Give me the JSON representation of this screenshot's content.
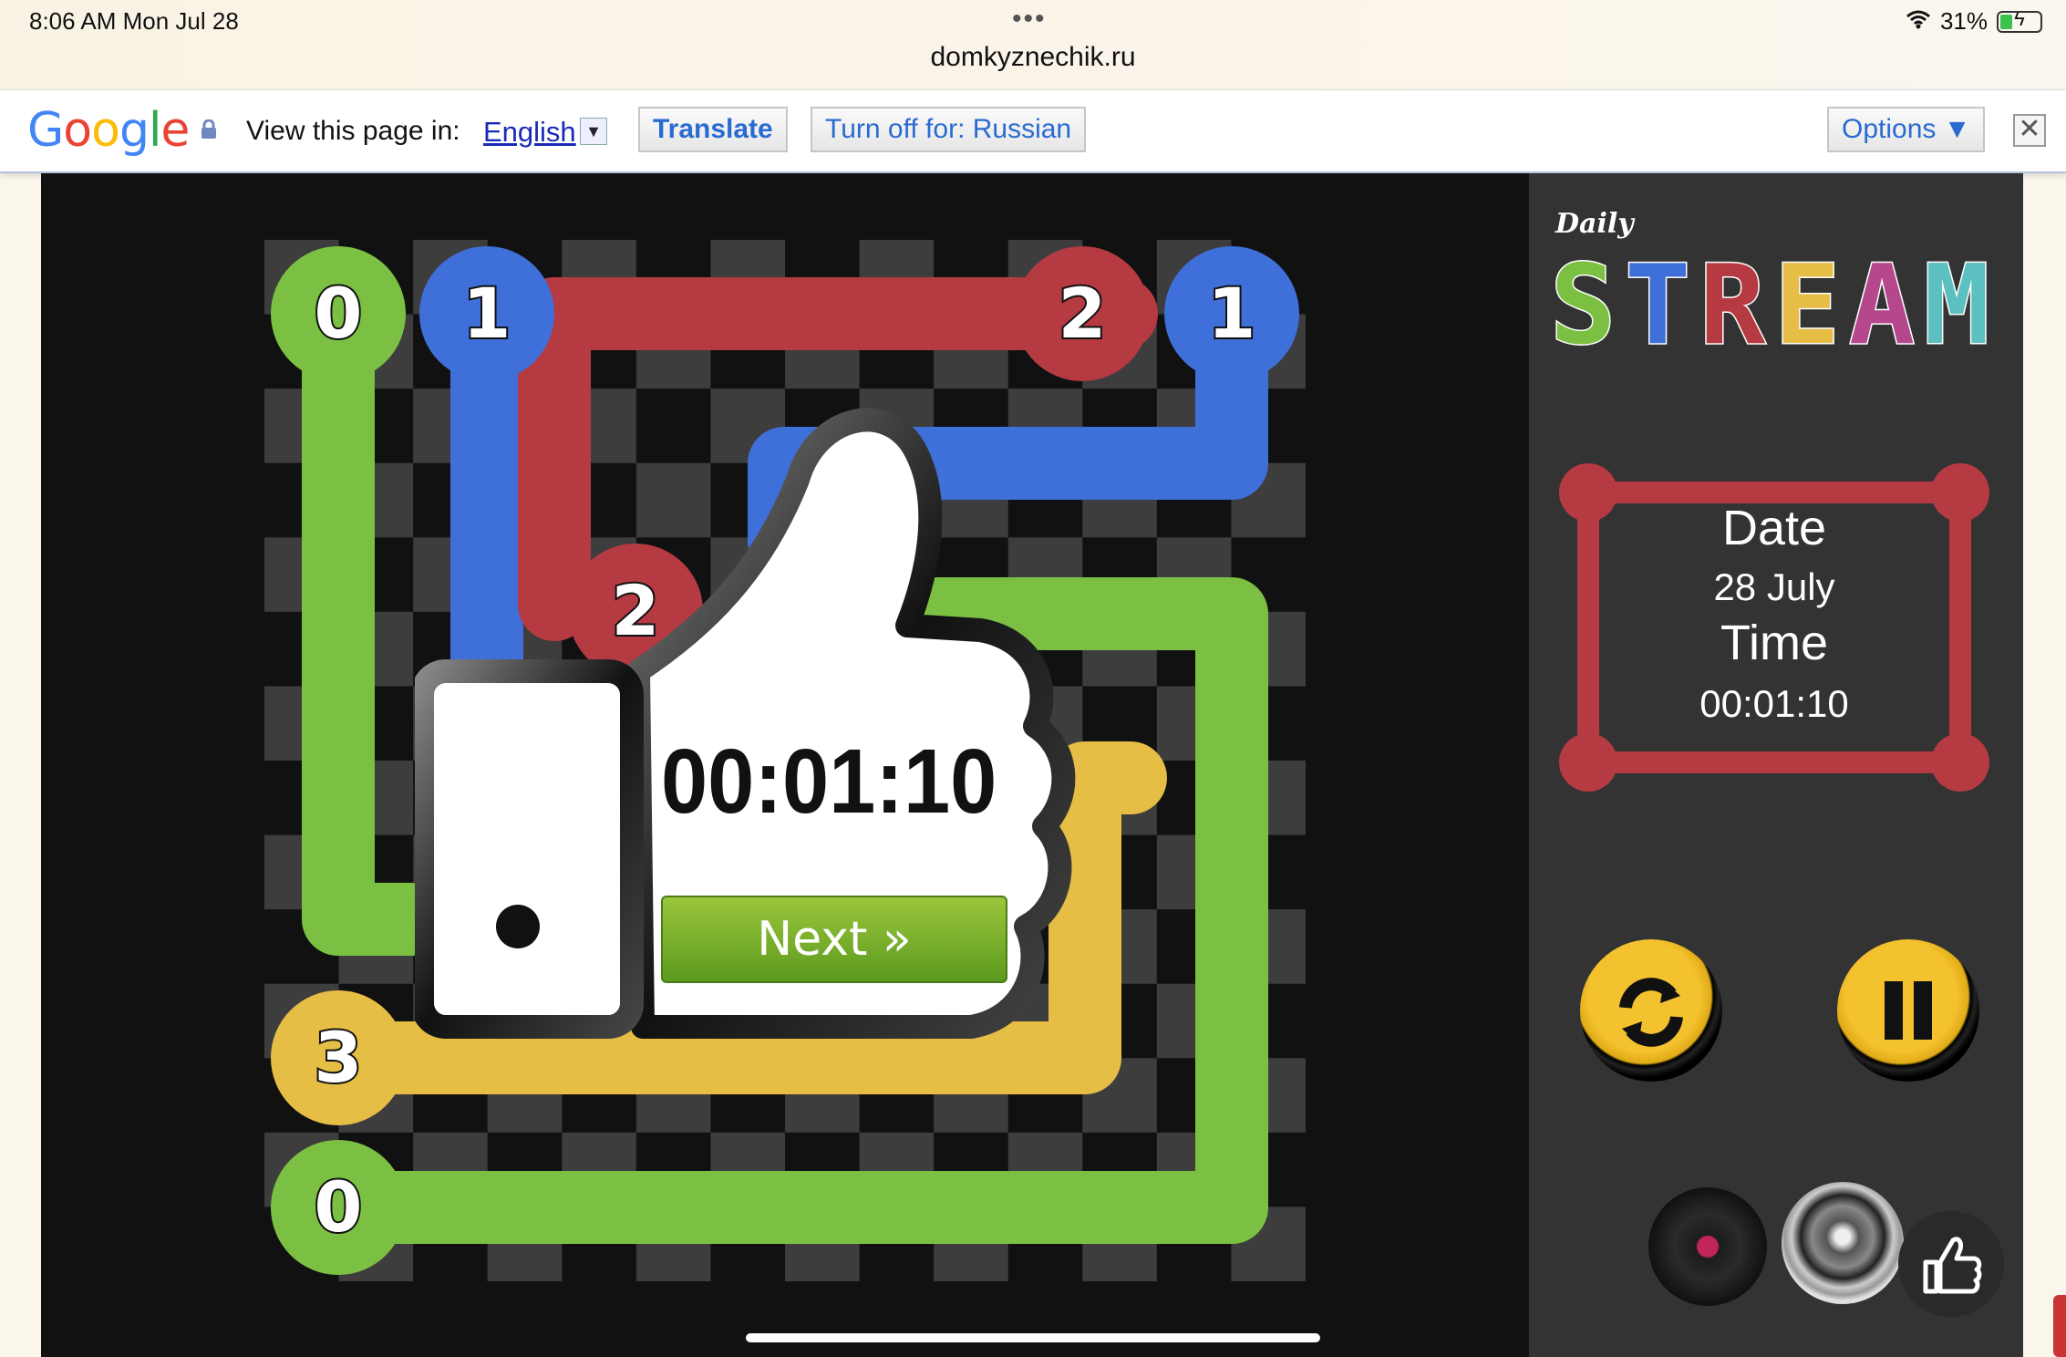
{
  "status_bar": {
    "time": "8:06 AM  Mon Jul 28",
    "url": "domkyznechik.ru",
    "battery": "31%",
    "battery_level": 0.31
  },
  "translate_bar": {
    "logo": "Google",
    "prompt": "View this page in:",
    "language": "English",
    "translate_button": "Translate",
    "turn_off_button": "Turn off for: Russian",
    "options_button": "Options ▼",
    "close": "✕"
  },
  "game": {
    "nodes": [
      {
        "label": "0",
        "color": "#7bc043"
      },
      {
        "label": "1",
        "color": "#3f6fd9"
      },
      {
        "label": "2",
        "color": "#b53a42"
      },
      {
        "label": "1",
        "color": "#3f6fd9"
      },
      {
        "label": "2",
        "color": "#b53a42"
      },
      {
        "label": "3",
        "color": "#e6bd45"
      },
      {
        "label": "0",
        "color": "#7bc043"
      }
    ],
    "overlay": {
      "timer": "00:01:10",
      "next_button": "Next »"
    }
  },
  "sidebar": {
    "logo_small": "Daily",
    "logo_big": "STREAM",
    "date_label": "Date",
    "date_value": "28 July",
    "time_label": "Time",
    "time_value": "00:01:10"
  },
  "colors": {
    "green": "#7bc043",
    "blue": "#3f6fd9",
    "red": "#b53a42",
    "yellow": "#e6bd45",
    "board_dark": "#111111",
    "board_light": "#3d3d3d"
  }
}
